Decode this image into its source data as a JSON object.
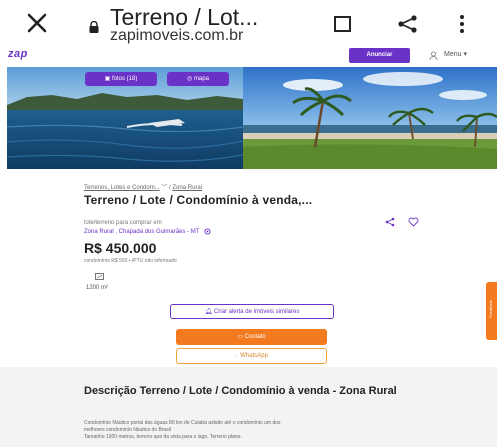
{
  "browser": {
    "title": "Terreno / Lot...",
    "url": "zapimoveis.com.br"
  },
  "header": {
    "logo": "zap",
    "anunciar_label": "Anunciar",
    "menu_label": "Menu ▾"
  },
  "gallery": {
    "fotos_label": "fotos (18)",
    "mapa_label": "mapa"
  },
  "listing": {
    "breadcrumb_1": "Terrenos, Lotes e Condom...",
    "breadcrumb_sep": " ﹀ / ",
    "breadcrumb_2": "Zona Rural",
    "title": "Terreno / Lote / Condomínio à venda,...",
    "type_line": "lote/terreno para comprar em",
    "location": "Zona Rural , Chapada dos Guimarães - MT",
    "price": "R$ 450.000",
    "fees": "condomínio R$ 500  •  IPTU não informado",
    "area": "1200 m²"
  },
  "actions": {
    "alert_label": "Criar alerta de imóveis similares",
    "contato_label": "Contato",
    "whatsapp_label": "WhatsApp",
    "side_tab_label": "Feedback"
  },
  "description": {
    "title": "Descrição Terreno / Lote / Condomínio à venda - Zona Rural",
    "line1": "Condomínio Náutico portal das águas 80 km de Cuiabá asfalto até o condomínio um dos",
    "line2": "melhores condomínio Náutico do Brasil",
    "line3": "Tamanho 1200 metros, terreno que da vista para o lago. Terreno plano."
  },
  "colors": {
    "brand": "#6b32c7",
    "accent": "#f47a1f"
  }
}
